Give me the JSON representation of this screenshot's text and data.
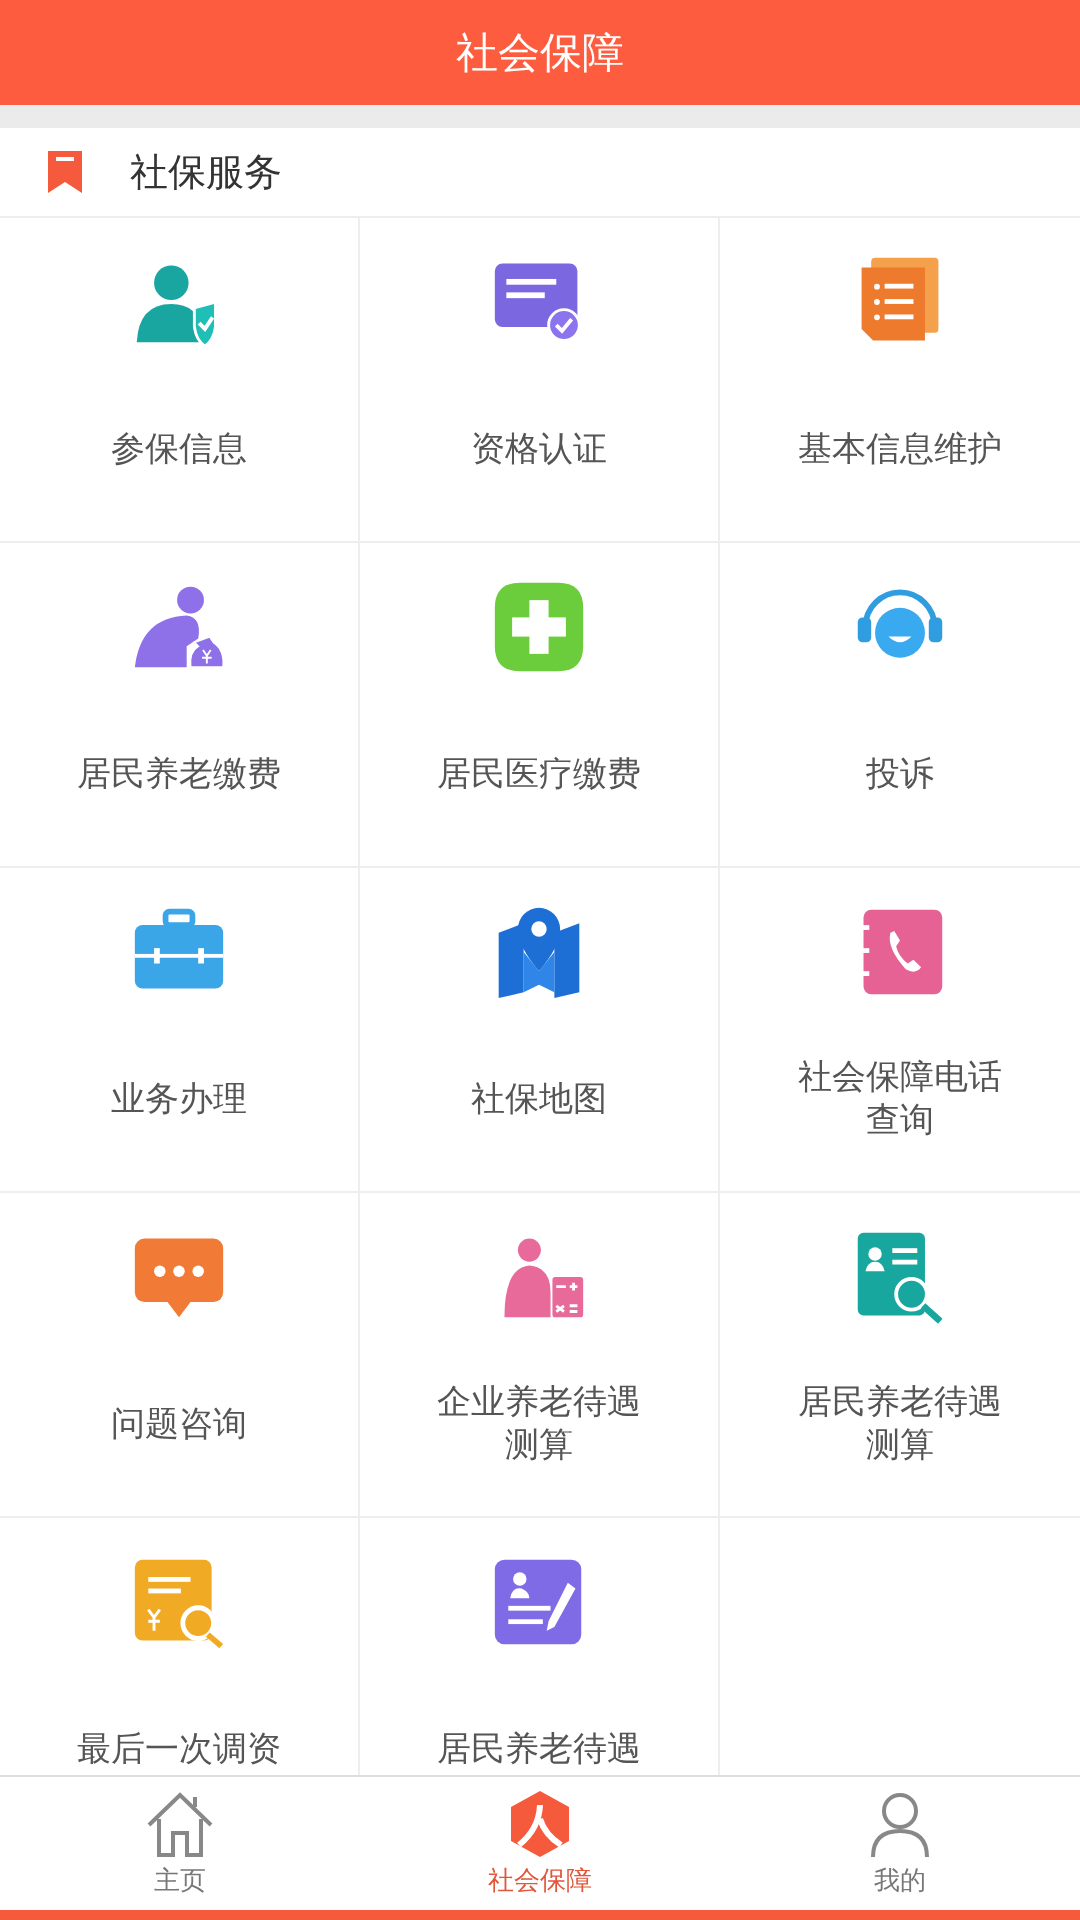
{
  "header": {
    "title": "社会保障"
  },
  "section": {
    "title": "社保服务"
  },
  "services": [
    {
      "label": "参保信息"
    },
    {
      "label": "资格认证"
    },
    {
      "label": "基本信息维护"
    },
    {
      "label": "居民养老缴费"
    },
    {
      "label": "居民医疗缴费"
    },
    {
      "label": "投诉"
    },
    {
      "label": "业务办理"
    },
    {
      "label": "社保地图"
    },
    {
      "label": "社会保障电话查询"
    },
    {
      "label": "问题咨询"
    },
    {
      "label": "企业养老待遇测算"
    },
    {
      "label": "居民养老待遇测算"
    },
    {
      "label": "最后一次调资"
    },
    {
      "label": "居民养老待遇"
    }
  ],
  "tabs": [
    {
      "label": "主页",
      "selected": false
    },
    {
      "label": "社会保障",
      "selected": true
    },
    {
      "label": "我的",
      "selected": false
    }
  ]
}
